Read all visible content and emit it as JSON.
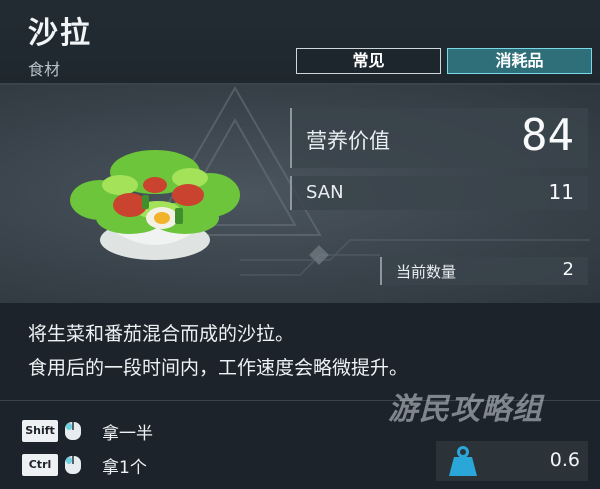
{
  "item": {
    "name": "沙拉",
    "type": "食材",
    "rarity": "常见",
    "category": "消耗品"
  },
  "stats": {
    "nutrition_label": "营养价值",
    "nutrition_value": "84",
    "san_label": "SAN",
    "san_value": "11",
    "quantity_label": "当前数量",
    "quantity_value": "2"
  },
  "description": {
    "line1": "将生菜和番茄混合而成的沙拉。",
    "line2": "食用后的一段时间内，工作速度会略微提升。"
  },
  "controls": [
    {
      "key": "Shift",
      "action": "拿一半"
    },
    {
      "key": "Ctrl",
      "action": "拿1个"
    }
  ],
  "weight": {
    "value": "0.6",
    "icon": "weight-icon"
  },
  "watermark": "游民攻略组",
  "colors": {
    "category_tag": "#2f6f7a",
    "accent": "#7ad9e6",
    "weight_icon": "#2aa7d8"
  }
}
